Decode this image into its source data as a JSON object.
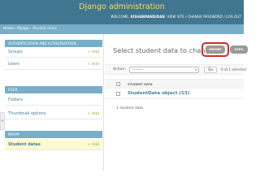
{
  "header": {
    "brand": "Django administration",
    "welcome": "WELCOME, ",
    "username": "KISHANPANDIDAN",
    "welcome_end": ". ",
    "view_site": "VIEW SITE",
    "change_password": "CHANGE PASSWORD",
    "log_out": "LOG OUT",
    "separator": " / "
  },
  "breadcrumbs": {
    "home": "Home",
    "sep": " › ",
    "app": "Myapp",
    "current": "Student datas"
  },
  "sidebar": {
    "modules": [
      {
        "title": "AUTHENTICATION AND AUTHORIZATION",
        "items": [
          {
            "label": "Groups",
            "add": "+ Add"
          },
          {
            "label": "Users",
            "add": "+ Add"
          }
        ]
      },
      {
        "title": "FILER",
        "items": [
          {
            "label": "Folders",
            "add": ""
          },
          {
            "label": "Thumbnail options",
            "add": "+ Add"
          }
        ]
      },
      {
        "title": "MYAPP",
        "items": [
          {
            "label": "Student datas",
            "add": "+ Add"
          }
        ]
      }
    ],
    "collapse_glyph": "«"
  },
  "content": {
    "title": "Select student data to change",
    "import_label": "IMPORT",
    "export_label": "EXPO",
    "action_label": "Action:",
    "action_value": "---------",
    "go_label": "Go",
    "selected_count": "0 of 1 selected",
    "column_header": "STUDENT DATA",
    "row_label": "StudentData object (13)",
    "result_count": "1 student data"
  },
  "colors": {
    "header": "#417690",
    "brand": "#f5dd5d",
    "module": "#79aec8",
    "link": "#447e9b",
    "add": "#70bf2b",
    "highlight": "#d42a2a"
  }
}
